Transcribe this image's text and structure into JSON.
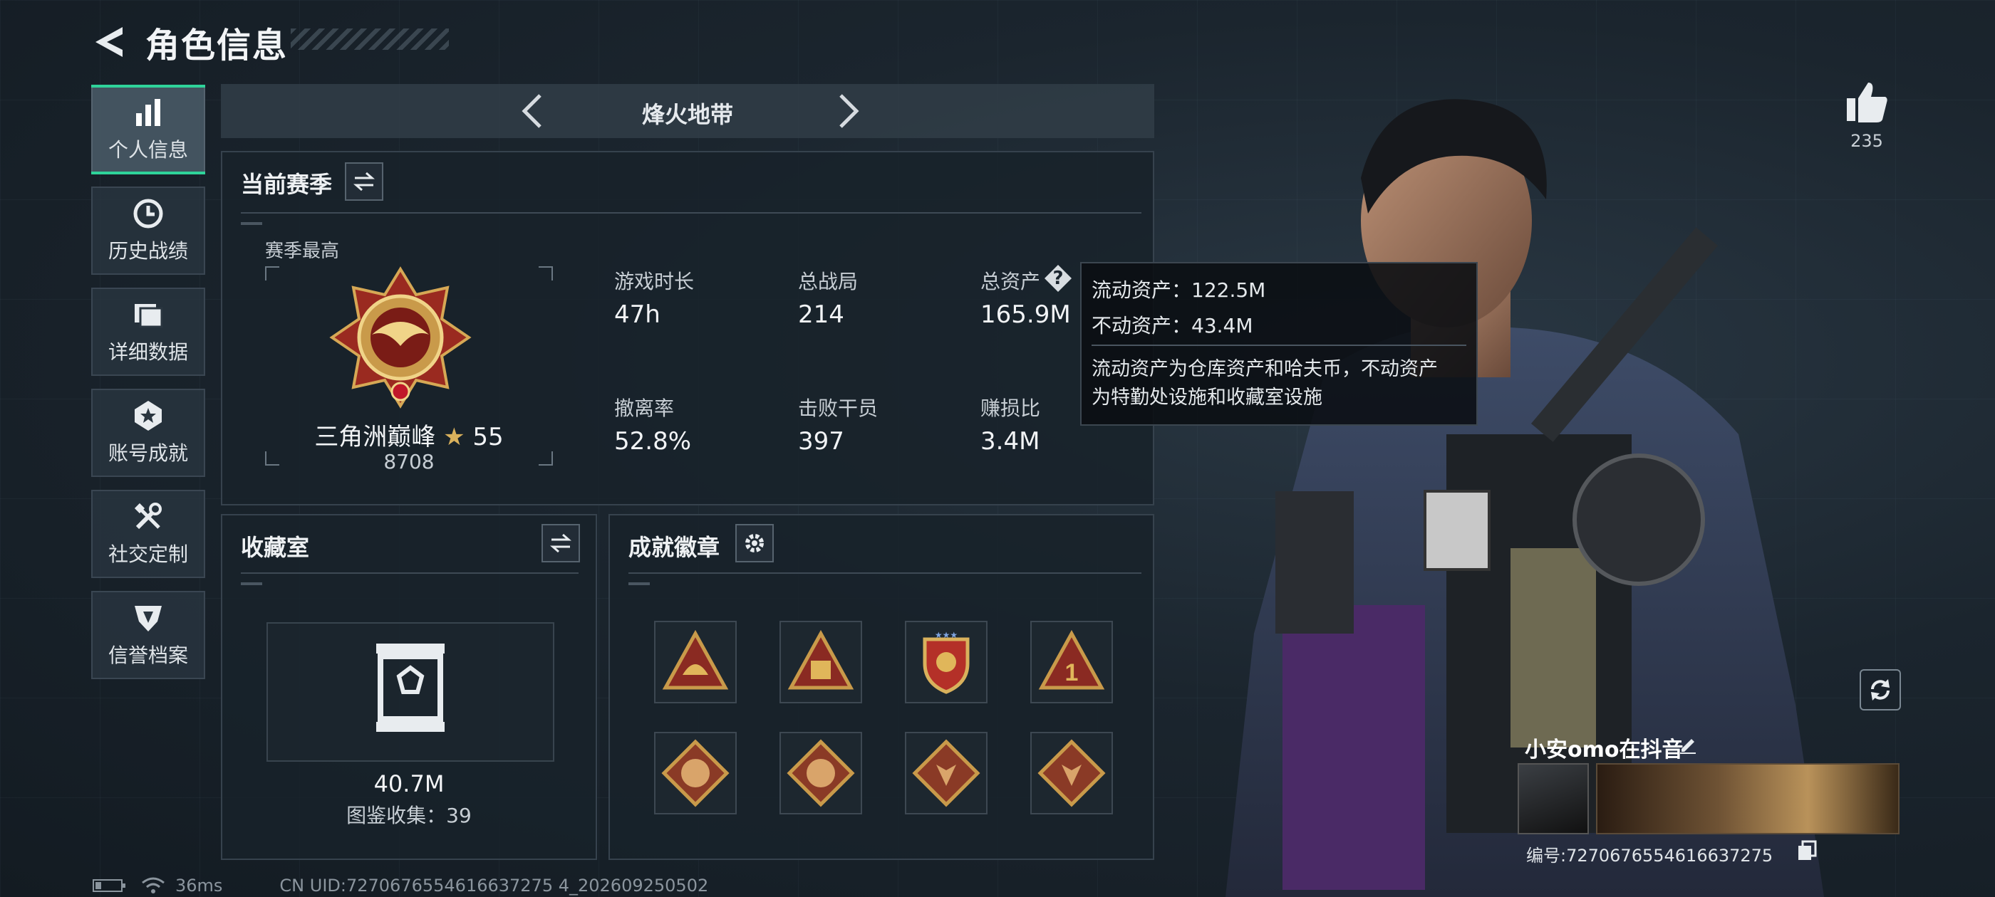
{
  "header": {
    "title": "角色信息"
  },
  "sidebar": {
    "items": [
      {
        "label": "个人信息",
        "icon": "bar-chart-icon",
        "active": true
      },
      {
        "label": "历史战绩",
        "icon": "clock-icon"
      },
      {
        "label": "详细数据",
        "icon": "folder-icon"
      },
      {
        "label": "账号成就",
        "icon": "star-badge-icon"
      },
      {
        "label": "社交定制",
        "icon": "tools-icon"
      },
      {
        "label": "信誉档案",
        "icon": "shield-icon"
      }
    ]
  },
  "mode_selector": {
    "name": "烽火地带"
  },
  "season": {
    "title": "当前赛季",
    "best_label": "赛季最高",
    "rank_name": "三角洲巅峰",
    "rank_stars": "55",
    "rank_points": "8708",
    "stats": [
      {
        "label": "游戏时长",
        "value": "47h"
      },
      {
        "label": "总战局",
        "value": "214"
      },
      {
        "label": "总资产",
        "value": "165.9M"
      },
      {
        "label": "撤离率",
        "value": "52.8%"
      },
      {
        "label": "击败干员",
        "value": "397"
      },
      {
        "label": "赚损比",
        "value": "3.4M"
      }
    ]
  },
  "tooltip": {
    "liquid": "流动资产：122.5M",
    "fixed": "不动资产：43.4M",
    "desc_line1": "流动资产为仓库资产和哈夫币，不动资产",
    "desc_line2": "为特勤处设施和收藏室设施"
  },
  "collection": {
    "title": "收藏室",
    "value": "40.7M",
    "catalog": "图鉴收集：39"
  },
  "badges": {
    "title": "成就徽章",
    "count": 8
  },
  "social": {
    "likes": "235"
  },
  "player_card": {
    "name": "小安omo在抖音",
    "id": "编号:7270676554616637275"
  },
  "status": {
    "ping": "36ms",
    "uid": "CN UID:7270676554616637275 4_202609250502"
  },
  "colors": {
    "accent": "#2fd39a",
    "panel_bg": "#18222a",
    "badge_red": "#8a2a22",
    "badge_gold": "#c99a4a"
  }
}
